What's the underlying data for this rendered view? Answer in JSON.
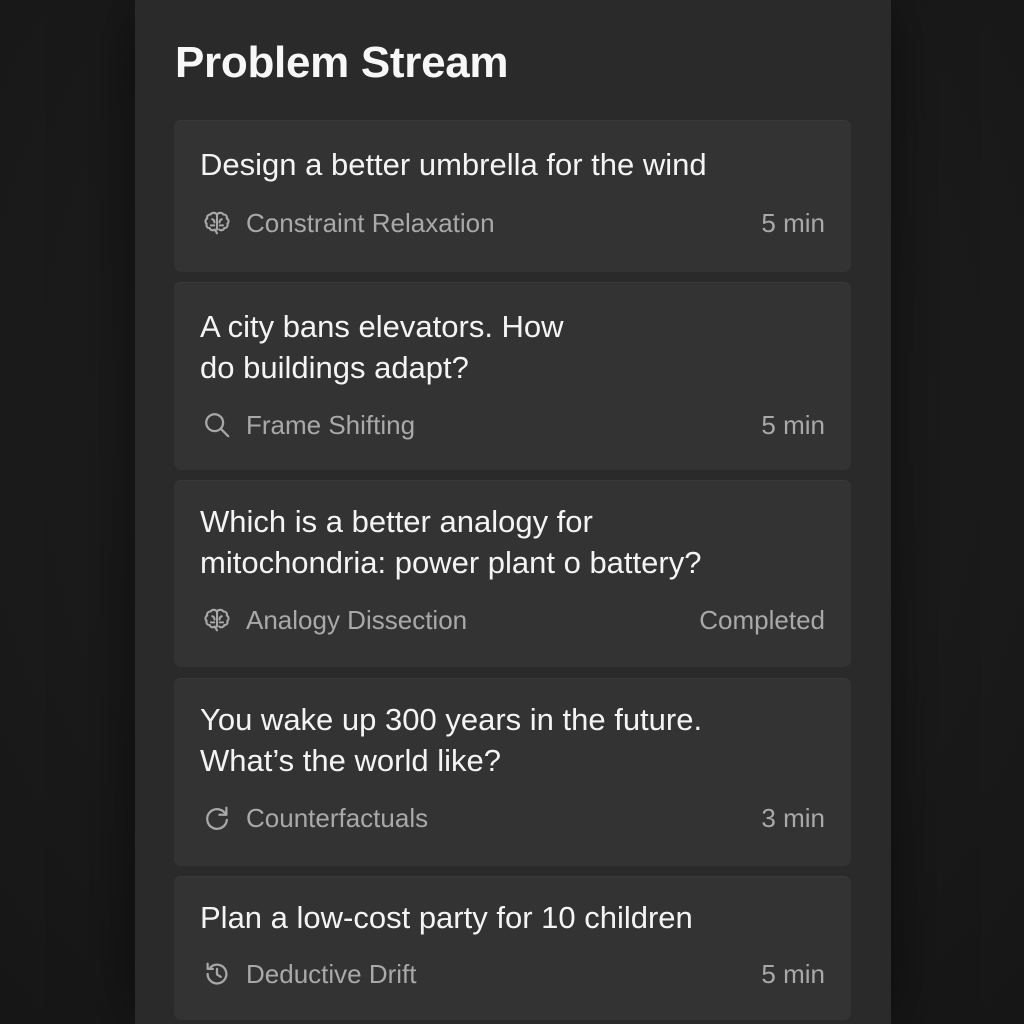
{
  "header": {
    "title": "Problem Stream"
  },
  "problems": [
    {
      "title": "Design a better umbrella for the wind",
      "icon": "brain-icon",
      "category": "Constraint Relaxation",
      "duration": "5 min"
    },
    {
      "title": "A city bans elevators. How\ndo buildings adapt?",
      "icon": "search-icon",
      "category": "Frame Shifting",
      "duration": "5 min"
    },
    {
      "title": "Which is a better analogy for\nmitochondria: power plant o battery?",
      "icon": "brain-icon",
      "category": "Analogy Dissection",
      "duration": "Completed"
    },
    {
      "title": "You wake up 300 years in the future.\nWhat’s the world like?",
      "icon": "refresh-icon",
      "category": "Counterfactuals",
      "duration": "3 min"
    },
    {
      "title": "Plan a low-cost party for 10 children",
      "icon": "history-icon",
      "category": "Deductive Drift",
      "duration": "5 min"
    }
  ]
}
